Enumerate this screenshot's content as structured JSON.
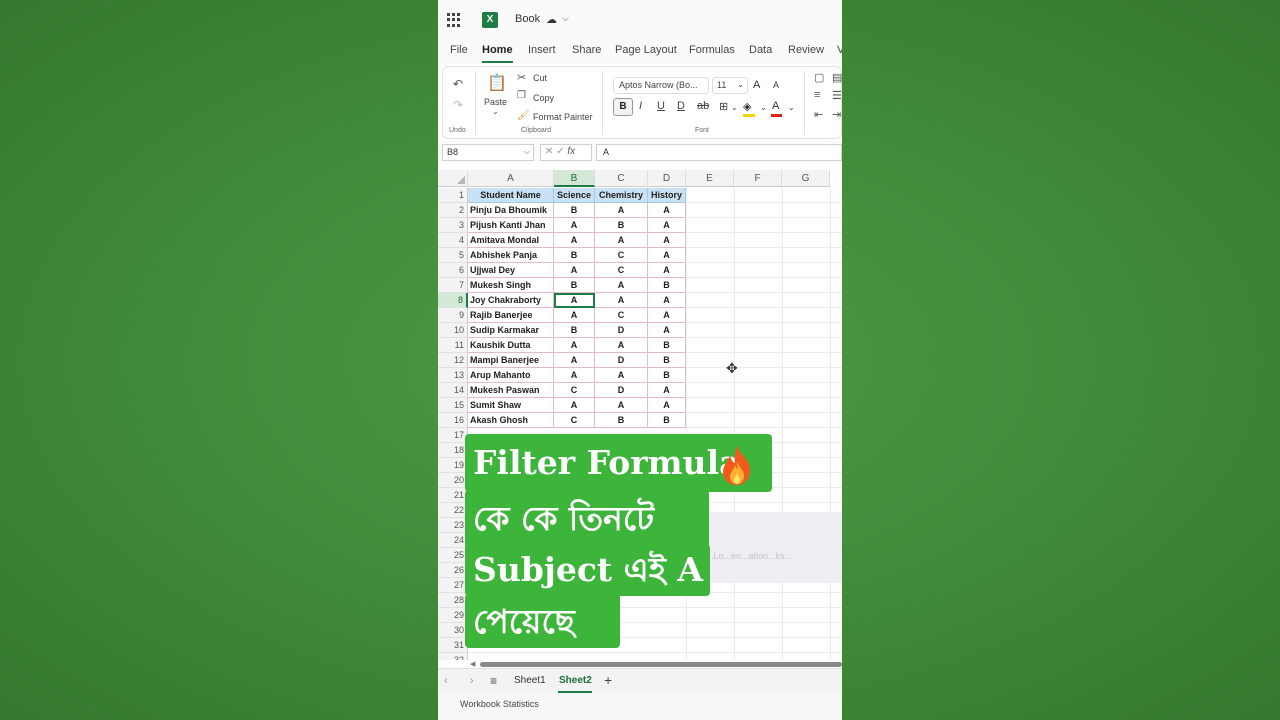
{
  "app": {
    "title": "Book",
    "menu": [
      "File",
      "Home",
      "Insert",
      "Share",
      "Page Layout",
      "Formulas",
      "Data",
      "Review",
      "V"
    ],
    "active_menu": "Home"
  },
  "ribbon": {
    "undo_group": "Undo",
    "paste": "Paste",
    "cut": "Cut",
    "copy": "Copy",
    "format_painter": "Format Painter",
    "clipboard_group": "Clipboard",
    "font_name": "Aptos Narrow (Bo...",
    "font_size": "11",
    "bold": "B",
    "italic": "I",
    "underline": "U",
    "double_underline": "D",
    "strikethrough": "ab",
    "grow_font": "A",
    "shrink_font": "A",
    "font_group": "Font"
  },
  "formula_bar": {
    "name_box": "B8",
    "formula": "A"
  },
  "grid": {
    "columns": [
      "A",
      "B",
      "C",
      "D",
      "E",
      "F",
      "G"
    ],
    "selected_column": "B",
    "selected_row": 8,
    "row_numbers": [
      1,
      2,
      3,
      4,
      5,
      6,
      7,
      8,
      9,
      10,
      11,
      12,
      13,
      14,
      15,
      16,
      17,
      18,
      19,
      20,
      21,
      22,
      23,
      24,
      25,
      26,
      27,
      28,
      29,
      30,
      31,
      32
    ],
    "headers": [
      "Student Name",
      "Science",
      "Chemistry",
      "History"
    ],
    "rows": [
      [
        "Pinju Da Bhoumik",
        "B",
        "A",
        "A"
      ],
      [
        "Pijush Kanti Jhan",
        "A",
        "B",
        "A"
      ],
      [
        "Amitava Mondal",
        "A",
        "A",
        "A"
      ],
      [
        "Abhishek Panja",
        "B",
        "C",
        "A"
      ],
      [
        "Ujjwal Dey",
        "A",
        "C",
        "A"
      ],
      [
        "Mukesh Singh",
        "B",
        "A",
        "B"
      ],
      [
        "Joy Chakraborty",
        "A",
        "A",
        "A"
      ],
      [
        "Rajib Banerjee",
        "A",
        "C",
        "A"
      ],
      [
        "Sudip Karmakar",
        "B",
        "D",
        "A"
      ],
      [
        "Kaushik Dutta",
        "A",
        "A",
        "B"
      ],
      [
        "Mampi Banerjee",
        "A",
        "D",
        "B"
      ],
      [
        "Arup Mahanto",
        "A",
        "A",
        "B"
      ],
      [
        "Mukesh Paswan",
        "C",
        "D",
        "A"
      ],
      [
        "Sumit Shaw",
        "A",
        "A",
        "A"
      ],
      [
        "Akash Ghosh",
        "C",
        "B",
        "B"
      ]
    ],
    "ghost_text": "...Lo...en...ation...ks...",
    "pointer_icon": "crosshair-cursor-icon"
  },
  "sheets": {
    "tabs": [
      "Sheet1",
      "Sheet2"
    ],
    "active": "Sheet2",
    "add": "+"
  },
  "status": {
    "text": "Workbook Statistics"
  },
  "caption": {
    "line1": "Filter Formula",
    "line2": "কে কে তিনটে",
    "line3": "Subject এই A",
    "line4": "পেয়েছে",
    "emoji": "fire-icon"
  },
  "colors": {
    "accent": "#1d7d45",
    "caption_bg": "#3db43a",
    "header_fill": "#c9e1f4",
    "background": "#3f8a38"
  }
}
